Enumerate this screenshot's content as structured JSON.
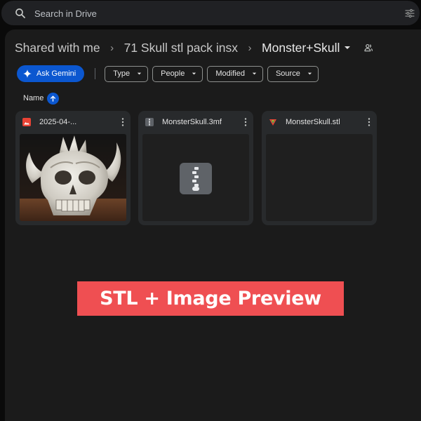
{
  "search": {
    "placeholder": "Search in Drive",
    "icon": "search-icon",
    "filter_icon": "search-options-icon"
  },
  "breadcrumb": {
    "items": [
      "Shared with me",
      "71 Skull stl pack insx",
      "Monster+Skull"
    ],
    "separator": "›"
  },
  "filters": {
    "ask_gemini": "Ask Gemini",
    "chips": [
      "Type",
      "People",
      "Modified",
      "Source"
    ]
  },
  "sort": {
    "label": "Name",
    "direction": "ascending"
  },
  "files": [
    {
      "name": "2025-04-...",
      "icon": "image-file-icon",
      "icon_color": "#ea4335",
      "preview": "skull-image"
    },
    {
      "name": "MonsterSkull.3mf",
      "icon": "zip-file-icon",
      "icon_color": "#9aa0a6",
      "preview": "archive"
    },
    {
      "name": "MonsterSkull.stl",
      "icon": "stl-file-icon",
      "icon_color": "#34a853",
      "preview": "empty"
    }
  ],
  "overlay": {
    "banner_text": "STL + Image Preview"
  },
  "colors": {
    "accent": "#0b57d0",
    "banner": "#ef4f52",
    "card": "#282a2c",
    "panel": "#1b1b1b"
  }
}
